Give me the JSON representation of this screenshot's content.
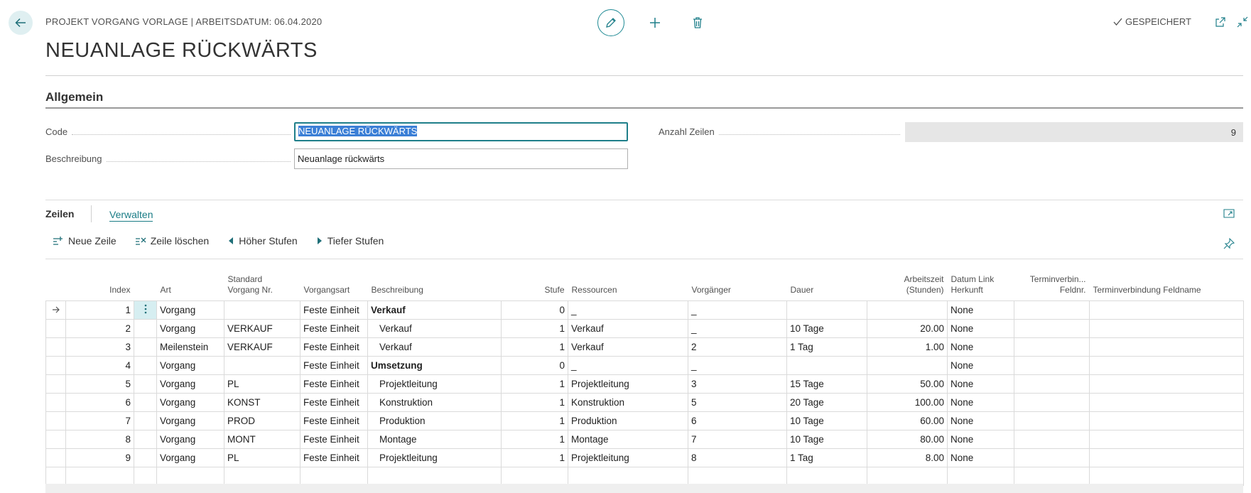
{
  "header": {
    "breadcrumb": "PROJEKT VORGANG VORLAGE | ARBEITSDATUM: 06.04.2020",
    "title": "NEUANLAGE RÜCKWÄRTS",
    "saved_label": "GESPEICHERT"
  },
  "general": {
    "section_title": "Allgemein",
    "code_label": "Code",
    "code_value": "NEUANLAGE RÜCKWÄRTS",
    "description_label": "Beschreibung",
    "description_value": "Neuanlage rückwärts",
    "line_count_label": "Anzahl Zeilen",
    "line_count_value": "9"
  },
  "lines": {
    "tab_label": "Zeilen",
    "manage_label": "Verwalten",
    "actions": [
      "Neue Zeile",
      "Zeile löschen",
      "Höher Stufen",
      "Tiefer Stufen"
    ],
    "columns": {
      "index": "Index",
      "art": "Art",
      "standard_vorgang_1": "Standard",
      "standard_vorgang_2": "Vorgang Nr.",
      "vorgangsart": "Vorgangsart",
      "beschreibung": "Beschreibung",
      "stufe": "Stufe",
      "ressourcen": "Ressourcen",
      "vorgaenger": "Vorgänger",
      "dauer": "Dauer",
      "arbeitszeit_1": "Arbeitszeit",
      "arbeitszeit_2": "(Stunden)",
      "datum_link_1": "Datum Link",
      "datum_link_2": "Herkunft",
      "terminverbindung_feldnr_1": "Terminverbin...",
      "terminverbindung_feldnr_2": "Feldnr.",
      "terminverbindung_feldname": "Terminverbindung Feldname"
    },
    "rows": [
      {
        "index": "1",
        "art": "Vorgang",
        "standard": "",
        "vorgangsart": "Feste Einheit",
        "beschreibung": "Verkauf",
        "stufe": "0",
        "ressourcen": "_",
        "vorgaenger": "_",
        "dauer": "",
        "arbeitszeit": "",
        "datum_link": "None",
        "feldnr": "",
        "feldname": ""
      },
      {
        "index": "2",
        "art": "Vorgang",
        "standard": "VERKAUF",
        "vorgangsart": "Feste Einheit",
        "beschreibung": "Verkauf",
        "stufe": "1",
        "ressourcen": "Verkauf",
        "vorgaenger": "_",
        "dauer": "10 Tage",
        "arbeitszeit": "20.00",
        "datum_link": "None",
        "feldnr": "",
        "feldname": ""
      },
      {
        "index": "3",
        "art": "Meilenstein",
        "standard": "VERKAUF",
        "vorgangsart": "Feste Einheit",
        "beschreibung": "Verkauf",
        "stufe": "1",
        "ressourcen": "Verkauf",
        "vorgaenger": "2",
        "dauer": "1 Tag",
        "arbeitszeit": "1.00",
        "datum_link": "None",
        "feldnr": "",
        "feldname": ""
      },
      {
        "index": "4",
        "art": "Vorgang",
        "standard": "",
        "vorgangsart": "Feste Einheit",
        "beschreibung": "Umsetzung",
        "stufe": "0",
        "ressourcen": "_",
        "vorgaenger": "_",
        "dauer": "",
        "arbeitszeit": "",
        "datum_link": "None",
        "feldnr": "",
        "feldname": ""
      },
      {
        "index": "5",
        "art": "Vorgang",
        "standard": "PL",
        "vorgangsart": "Feste Einheit",
        "beschreibung": "Projektleitung",
        "stufe": "1",
        "ressourcen": "Projektleitung",
        "vorgaenger": "3",
        "dauer": "15 Tage",
        "arbeitszeit": "50.00",
        "datum_link": "None",
        "feldnr": "",
        "feldname": ""
      },
      {
        "index": "6",
        "art": "Vorgang",
        "standard": "KONST",
        "vorgangsart": "Feste Einheit",
        "beschreibung": "Konstruktion",
        "stufe": "1",
        "ressourcen": "Konstruktion",
        "vorgaenger": "5",
        "dauer": "20 Tage",
        "arbeitszeit": "100.00",
        "datum_link": "None",
        "feldnr": "",
        "feldname": ""
      },
      {
        "index": "7",
        "art": "Vorgang",
        "standard": "PROD",
        "vorgangsart": "Feste Einheit",
        "beschreibung": "Produktion",
        "stufe": "1",
        "ressourcen": "Produktion",
        "vorgaenger": "6",
        "dauer": "10 Tage",
        "arbeitszeit": "60.00",
        "datum_link": "None",
        "feldnr": "",
        "feldname": ""
      },
      {
        "index": "8",
        "art": "Vorgang",
        "standard": "MONT",
        "vorgangsart": "Feste Einheit",
        "beschreibung": "Montage",
        "stufe": "1",
        "ressourcen": "Montage",
        "vorgaenger": "7",
        "dauer": "10 Tage",
        "arbeitszeit": "80.00",
        "datum_link": "None",
        "feldnr": "",
        "feldname": ""
      },
      {
        "index": "9",
        "art": "Vorgang",
        "standard": "PL",
        "vorgangsart": "Feste Einheit",
        "beschreibung": "Projektleitung",
        "stufe": "1",
        "ressourcen": "Projektleitung",
        "vorgaenger": "8",
        "dauer": "1 Tag",
        "arbeitszeit": "8.00",
        "datum_link": "None",
        "feldnr": "",
        "feldname": ""
      }
    ]
  }
}
